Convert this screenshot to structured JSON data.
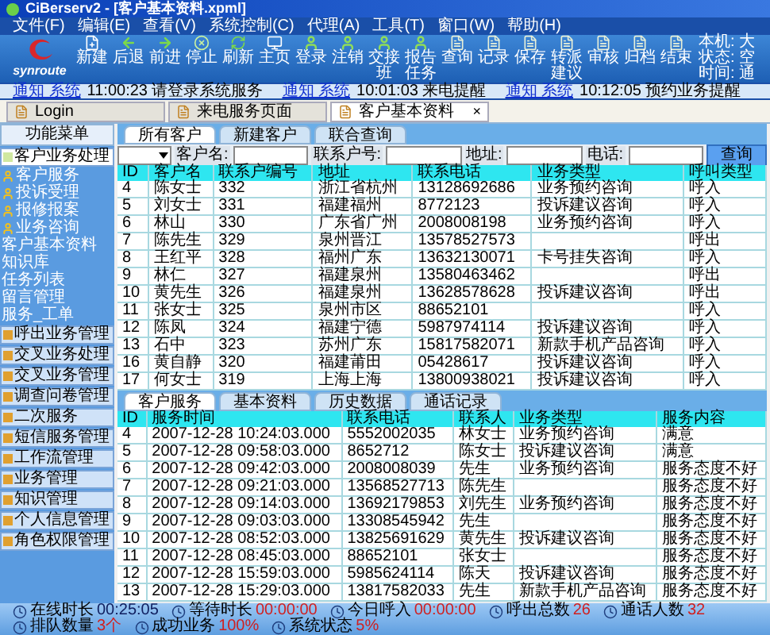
{
  "window": {
    "title": "CiBerserv2 - [客户基本资料.xpml]"
  },
  "menu": [
    "文件(F)",
    "编辑(E)",
    "查看(V)",
    "系统控制(C)",
    "代理(A)",
    "工具(T)",
    "窗口(W)",
    "帮助(H)"
  ],
  "logo": {
    "text": "synroute"
  },
  "toolbar": [
    {
      "label": "新建",
      "kind": "new"
    },
    {
      "label": "后退",
      "kind": "back"
    },
    {
      "label": "前进",
      "kind": "forward"
    },
    {
      "label": "停止",
      "kind": "stop"
    },
    {
      "label": "刷新",
      "kind": "refresh"
    },
    {
      "label": "主页",
      "kind": "home"
    },
    {
      "label": "登录",
      "kind": "user"
    },
    {
      "label": "注销",
      "kind": "user"
    },
    {
      "label": "交接班",
      "kind": "user"
    },
    {
      "label": "报告任务",
      "kind": "user"
    },
    {
      "label": "查询",
      "kind": "doc"
    },
    {
      "label": "记录",
      "kind": "doc"
    },
    {
      "label": "保存",
      "kind": "doc"
    },
    {
      "label": "转派建议",
      "kind": "doc"
    },
    {
      "label": "审核",
      "kind": "doc"
    },
    {
      "label": "归档",
      "kind": "doc"
    },
    {
      "label": "结束",
      "kind": "doc"
    }
  ],
  "toolbar_info": [
    "本机: 大",
    "状态: 空",
    "时间: 通"
  ],
  "notices": [
    {
      "source": "通知 系统",
      "text": "11:00:23 请登录系统服务"
    },
    {
      "source": "通知 系统",
      "text": "10:01:03 来电提醒"
    },
    {
      "source": "通知 系统",
      "text": "10:12:05 预约业务提醒"
    }
  ],
  "doc_tabs": [
    {
      "label": "Login",
      "selected": false
    },
    {
      "label": "来电服务页面",
      "selected": false
    },
    {
      "label": "客户基本资料",
      "selected": true,
      "close": "×"
    }
  ],
  "sidebar": {
    "title": "功能菜单",
    "sections": [
      {
        "label": "客户业务处理",
        "expanded": true,
        "children": [
          {
            "label": "客户服务",
            "kind": "icon"
          },
          {
            "label": "投诉受理",
            "kind": "icon"
          },
          {
            "label": "报修报案",
            "kind": "icon"
          },
          {
            "label": "业务咨询",
            "kind": "icon"
          },
          {
            "label": "客户基本资料",
            "kind": "text"
          },
          {
            "label": "知识库",
            "kind": "text"
          },
          {
            "label": "任务列表",
            "kind": "text"
          },
          {
            "label": "留言管理",
            "kind": "text"
          },
          {
            "label": "服务_工单",
            "kind": "text"
          }
        ]
      },
      {
        "label": "呼出业务管理",
        "expanded": false
      },
      {
        "label": "交叉业务处理",
        "expanded": false
      },
      {
        "label": "交叉业务管理",
        "expanded": false
      },
      {
        "label": "调查问卷管理",
        "expanded": false
      },
      {
        "label": "二次服务",
        "expanded": false
      },
      {
        "label": "短信服务管理",
        "expanded": false
      },
      {
        "label": "工作流管理",
        "expanded": false
      },
      {
        "label": "业务管理",
        "expanded": false
      },
      {
        "label": "知识管理",
        "expanded": false
      },
      {
        "label": "个人信息管理",
        "expanded": false
      },
      {
        "label": "角色权限管理",
        "expanded": false
      }
    ]
  },
  "customers": {
    "tabs": [
      {
        "label": "所有客户",
        "selected": true
      },
      {
        "label": "新建客户",
        "selected": false
      },
      {
        "label": "联合查询",
        "selected": false
      }
    ],
    "filter": {
      "fields": [
        "客户名:",
        "联系户号:",
        "地址:",
        "电话:"
      ],
      "button": "查询"
    },
    "columns": [
      "ID",
      "客户名",
      "联系户编号",
      "地址",
      "联系电话",
      "业务类型",
      "呼叫类型"
    ],
    "rows": [
      [
        "4",
        "陈女士",
        "332",
        "浙江省杭州",
        "13128692686",
        "业务预约咨询",
        "呼入"
      ],
      [
        "5",
        "刘女士",
        "331",
        "福建福州",
        "8772123",
        "投诉建议咨询",
        "呼入"
      ],
      [
        "6",
        "林山",
        "330",
        "广东省广州",
        "2008008198",
        "业务预约咨询",
        "呼入"
      ],
      [
        "7",
        "陈先生",
        "329",
        "泉州晋江",
        "13578527573",
        "",
        "呼出"
      ],
      [
        "8",
        "王红平",
        "328",
        "福州广东",
        "13632130071",
        "卡号挂失咨询",
        "呼入"
      ],
      [
        "9",
        "林仁",
        "327",
        "福建泉州",
        "13580463462",
        "",
        "呼出"
      ],
      [
        "10",
        "黄先生",
        "326",
        "福建泉州",
        "13628578628",
        "投诉建议咨询",
        "呼出"
      ],
      [
        "11",
        "张女士",
        "325",
        "泉州市区",
        "88652101",
        "",
        "呼入"
      ],
      [
        "12",
        "陈凤",
        "324",
        "福建宁德",
        "5987974114",
        "投诉建议咨询",
        "呼入"
      ],
      [
        "13",
        "石中",
        "323",
        "苏州广东",
        "15817582071",
        "新款手机产品咨询",
        "呼入"
      ],
      [
        "16",
        "黄自静",
        "320",
        "福建莆田",
        "05428617",
        "投诉建议咨询",
        "呼入"
      ],
      [
        "17",
        "何女士",
        "319",
        "上海上海",
        "13800938021",
        "投诉建议咨询",
        "呼入"
      ]
    ]
  },
  "services": {
    "tabs": [
      {
        "label": "客户服务",
        "selected": true
      },
      {
        "label": "基本资料",
        "selected": false
      },
      {
        "label": "历史数据",
        "selected": false
      },
      {
        "label": "通话记录",
        "selected": false
      }
    ],
    "columns": [
      "ID",
      "服务时间",
      "联系电话",
      "联系人",
      "业务类型",
      "服务内容"
    ],
    "rows": [
      [
        "4",
        "2007-12-28 10:24:03.000",
        "5552002035",
        "林女士",
        "业务预约咨询",
        "满意"
      ],
      [
        "5",
        "2007-12-28 09:58:03.000",
        "8652712",
        "陈女士",
        "投诉建议咨询",
        "满意"
      ],
      [
        "6",
        "2007-12-28 09:42:03.000",
        "2008008039",
        "先生",
        "业务预约咨询",
        "服务态度不好"
      ],
      [
        "7",
        "2007-12-28 09:21:03.000",
        "13568527713",
        "陈先生",
        "",
        "服务态度不好"
      ],
      [
        "8",
        "2007-12-28 09:14:03.000",
        "13692179853",
        "刘先生",
        "业务预约咨询",
        "服务态度不好"
      ],
      [
        "9",
        "2007-12-28 09:03:03.000",
        "13308545942",
        "先生",
        "",
        "服务态度不好"
      ],
      [
        "10",
        "2007-12-28 08:52:03.000",
        "13825691629",
        "黄先生",
        "投诉建议咨询",
        "服务态度不好"
      ],
      [
        "11",
        "2007-12-28 08:45:03.000",
        "88652101",
        "张女士",
        "",
        "服务态度不好"
      ],
      [
        "12",
        "2007-12-28 15:59:03.000",
        "5985624114",
        "陈天",
        "投诉建议咨询",
        "服务态度不好"
      ],
      [
        "13",
        "2007-12-28 15:29:03.000",
        "13817582033",
        "先生",
        "新款手机产品咨询",
        "服务态度不好"
      ]
    ]
  },
  "status_bar": [
    {
      "label": "在线时长",
      "value": "00:25:05",
      "highlight": false
    },
    {
      "label": "等待时长",
      "value": "00:00:00",
      "highlight": true
    },
    {
      "label": "今日呼入",
      "value": "00:00:00",
      "highlight": true
    },
    {
      "label": "呼出总数",
      "value": "26",
      "highlight": true
    },
    {
      "label": "通话人数",
      "value": "32",
      "highlight": true
    },
    {
      "label": "排队数量",
      "value": "3个",
      "highlight": true
    },
    {
      "label": "成功业务",
      "value": "100%",
      "highlight": true
    },
    {
      "label": "系统状态",
      "value": "5%",
      "highlight": true
    }
  ]
}
